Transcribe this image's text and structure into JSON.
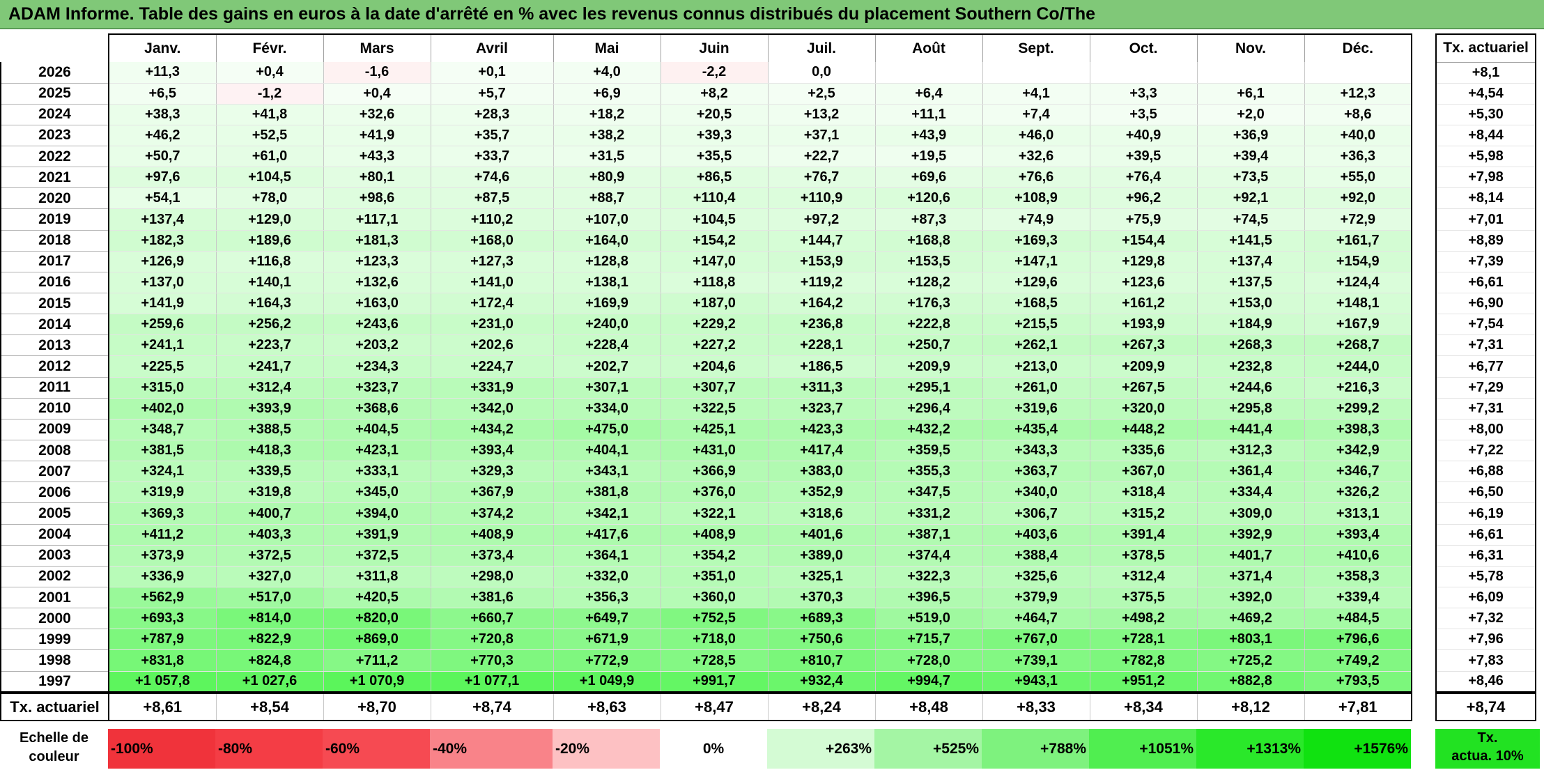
{
  "title": "ADAM Informe. Table des gains en euros à la date d'arrêté en % avec les revenus connus distribués du placement Southern Co/The",
  "months": [
    "Janv.",
    "Févr.",
    "Mars",
    "Avril",
    "Mai",
    "Juin",
    "Juil.",
    "Août",
    "Sept.",
    "Oct.",
    "Nov.",
    "Déc."
  ],
  "actuarial_header": "Tx. actuariel",
  "rows": [
    {
      "year": "2026",
      "cells": [
        "+11,3",
        "+0,4",
        "-1,6",
        "+0,1",
        "+4,0",
        "-2,2",
        "0,0",
        "",
        "",
        "",
        "",
        ""
      ],
      "rate": "+8,1"
    },
    {
      "year": "2025",
      "cells": [
        "+6,5",
        "-1,2",
        "+0,4",
        "+5,7",
        "+6,9",
        "+8,2",
        "+2,5",
        "+6,4",
        "+4,1",
        "+3,3",
        "+6,1",
        "+12,3"
      ],
      "rate": "+4,54"
    },
    {
      "year": "2024",
      "cells": [
        "+38,3",
        "+41,8",
        "+32,6",
        "+28,3",
        "+18,2",
        "+20,5",
        "+13,2",
        "+11,1",
        "+7,4",
        "+3,5",
        "+2,0",
        "+8,6"
      ],
      "rate": "+5,30"
    },
    {
      "year": "2023",
      "cells": [
        "+46,2",
        "+52,5",
        "+41,9",
        "+35,7",
        "+38,2",
        "+39,3",
        "+37,1",
        "+43,9",
        "+46,0",
        "+40,9",
        "+36,9",
        "+40,0"
      ],
      "rate": "+8,44"
    },
    {
      "year": "2022",
      "cells": [
        "+50,7",
        "+61,0",
        "+43,3",
        "+33,7",
        "+31,5",
        "+35,5",
        "+22,7",
        "+19,5",
        "+32,6",
        "+39,5",
        "+39,4",
        "+36,3"
      ],
      "rate": "+5,98"
    },
    {
      "year": "2021",
      "cells": [
        "+97,6",
        "+104,5",
        "+80,1",
        "+74,6",
        "+80,9",
        "+86,5",
        "+76,7",
        "+69,6",
        "+76,6",
        "+76,4",
        "+73,5",
        "+55,0"
      ],
      "rate": "+7,98"
    },
    {
      "year": "2020",
      "cells": [
        "+54,1",
        "+78,0",
        "+98,6",
        "+87,5",
        "+88,7",
        "+110,4",
        "+110,9",
        "+120,6",
        "+108,9",
        "+96,2",
        "+92,1",
        "+92,0"
      ],
      "rate": "+8,14"
    },
    {
      "year": "2019",
      "cells": [
        "+137,4",
        "+129,0",
        "+117,1",
        "+110,2",
        "+107,0",
        "+104,5",
        "+97,2",
        "+87,3",
        "+74,9",
        "+75,9",
        "+74,5",
        "+72,9"
      ],
      "rate": "+7,01"
    },
    {
      "year": "2018",
      "cells": [
        "+182,3",
        "+189,6",
        "+181,3",
        "+168,0",
        "+164,0",
        "+154,2",
        "+144,7",
        "+168,8",
        "+169,3",
        "+154,4",
        "+141,5",
        "+161,7"
      ],
      "rate": "+8,89"
    },
    {
      "year": "2017",
      "cells": [
        "+126,9",
        "+116,8",
        "+123,3",
        "+127,3",
        "+128,8",
        "+147,0",
        "+153,9",
        "+153,5",
        "+147,1",
        "+129,8",
        "+137,4",
        "+154,9"
      ],
      "rate": "+7,39"
    },
    {
      "year": "2016",
      "cells": [
        "+137,0",
        "+140,1",
        "+132,6",
        "+141,0",
        "+138,1",
        "+118,8",
        "+119,2",
        "+128,2",
        "+129,6",
        "+123,6",
        "+137,5",
        "+124,4"
      ],
      "rate": "+6,61"
    },
    {
      "year": "2015",
      "cells": [
        "+141,9",
        "+164,3",
        "+163,0",
        "+172,4",
        "+169,9",
        "+187,0",
        "+164,2",
        "+176,3",
        "+168,5",
        "+161,2",
        "+153,0",
        "+148,1"
      ],
      "rate": "+6,90"
    },
    {
      "year": "2014",
      "cells": [
        "+259,6",
        "+256,2",
        "+243,6",
        "+231,0",
        "+240,0",
        "+229,2",
        "+236,8",
        "+222,8",
        "+215,5",
        "+193,9",
        "+184,9",
        "+167,9"
      ],
      "rate": "+7,54"
    },
    {
      "year": "2013",
      "cells": [
        "+241,1",
        "+223,7",
        "+203,2",
        "+202,6",
        "+228,4",
        "+227,2",
        "+228,1",
        "+250,7",
        "+262,1",
        "+267,3",
        "+268,3",
        "+268,7"
      ],
      "rate": "+7,31"
    },
    {
      "year": "2012",
      "cells": [
        "+225,5",
        "+241,7",
        "+234,3",
        "+224,7",
        "+202,7",
        "+204,6",
        "+186,5",
        "+209,9",
        "+213,0",
        "+209,9",
        "+232,8",
        "+244,0"
      ],
      "rate": "+6,77"
    },
    {
      "year": "2011",
      "cells": [
        "+315,0",
        "+312,4",
        "+323,7",
        "+331,9",
        "+307,1",
        "+307,7",
        "+311,3",
        "+295,1",
        "+261,0",
        "+267,5",
        "+244,6",
        "+216,3"
      ],
      "rate": "+7,29"
    },
    {
      "year": "2010",
      "cells": [
        "+402,0",
        "+393,9",
        "+368,6",
        "+342,0",
        "+334,0",
        "+322,5",
        "+323,7",
        "+296,4",
        "+319,6",
        "+320,0",
        "+295,8",
        "+299,2"
      ],
      "rate": "+7,31"
    },
    {
      "year": "2009",
      "cells": [
        "+348,7",
        "+388,5",
        "+404,5",
        "+434,2",
        "+475,0",
        "+425,1",
        "+423,3",
        "+432,2",
        "+435,4",
        "+448,2",
        "+441,4",
        "+398,3"
      ],
      "rate": "+8,00"
    },
    {
      "year": "2008",
      "cells": [
        "+381,5",
        "+418,3",
        "+423,1",
        "+393,4",
        "+404,1",
        "+431,0",
        "+417,4",
        "+359,5",
        "+343,3",
        "+335,6",
        "+312,3",
        "+342,9"
      ],
      "rate": "+7,22"
    },
    {
      "year": "2007",
      "cells": [
        "+324,1",
        "+339,5",
        "+333,1",
        "+329,3",
        "+343,1",
        "+366,9",
        "+383,0",
        "+355,3",
        "+363,7",
        "+367,0",
        "+361,4",
        "+346,7"
      ],
      "rate": "+6,88"
    },
    {
      "year": "2006",
      "cells": [
        "+319,9",
        "+319,8",
        "+345,0",
        "+367,9",
        "+381,8",
        "+376,0",
        "+352,9",
        "+347,5",
        "+340,0",
        "+318,4",
        "+334,4",
        "+326,2"
      ],
      "rate": "+6,50"
    },
    {
      "year": "2005",
      "cells": [
        "+369,3",
        "+400,7",
        "+394,0",
        "+374,2",
        "+342,1",
        "+322,1",
        "+318,6",
        "+331,2",
        "+306,7",
        "+315,2",
        "+309,0",
        "+313,1"
      ],
      "rate": "+6,19"
    },
    {
      "year": "2004",
      "cells": [
        "+411,2",
        "+403,3",
        "+391,9",
        "+408,9",
        "+417,6",
        "+408,9",
        "+401,6",
        "+387,1",
        "+403,6",
        "+391,4",
        "+392,9",
        "+393,4"
      ],
      "rate": "+6,61"
    },
    {
      "year": "2003",
      "cells": [
        "+373,9",
        "+372,5",
        "+372,5",
        "+373,4",
        "+364,1",
        "+354,2",
        "+389,0",
        "+374,4",
        "+388,4",
        "+378,5",
        "+401,7",
        "+410,6"
      ],
      "rate": "+6,31"
    },
    {
      "year": "2002",
      "cells": [
        "+336,9",
        "+327,0",
        "+311,8",
        "+298,0",
        "+332,0",
        "+351,0",
        "+325,1",
        "+322,3",
        "+325,6",
        "+312,4",
        "+371,4",
        "+358,3"
      ],
      "rate": "+5,78"
    },
    {
      "year": "2001",
      "cells": [
        "+562,9",
        "+517,0",
        "+420,5",
        "+381,6",
        "+356,3",
        "+360,0",
        "+370,3",
        "+396,5",
        "+379,9",
        "+375,5",
        "+392,0",
        "+339,4"
      ],
      "rate": "+6,09"
    },
    {
      "year": "2000",
      "cells": [
        "+693,3",
        "+814,0",
        "+820,0",
        "+660,7",
        "+649,7",
        "+752,5",
        "+689,3",
        "+519,0",
        "+464,7",
        "+498,2",
        "+469,2",
        "+484,5"
      ],
      "rate": "+7,32"
    },
    {
      "year": "1999",
      "cells": [
        "+787,9",
        "+822,9",
        "+869,0",
        "+720,8",
        "+671,9",
        "+718,0",
        "+750,6",
        "+715,7",
        "+767,0",
        "+728,1",
        "+803,1",
        "+796,6"
      ],
      "rate": "+7,96"
    },
    {
      "year": "1998",
      "cells": [
        "+831,8",
        "+824,8",
        "+711,2",
        "+770,3",
        "+772,9",
        "+728,5",
        "+810,7",
        "+728,0",
        "+739,1",
        "+782,8",
        "+725,2",
        "+749,2"
      ],
      "rate": "+7,83"
    },
    {
      "year": "1997",
      "cells": [
        "+1 057,8",
        "+1 027,6",
        "+1 070,9",
        "+1 077,1",
        "+1 049,9",
        "+991,7",
        "+932,4",
        "+994,7",
        "+943,1",
        "+951,2",
        "+882,8",
        "+793,5"
      ],
      "rate": "+8,46"
    }
  ],
  "footer": {
    "label": "Tx. actuariel",
    "values": [
      "+8,61",
      "+8,54",
      "+8,70",
      "+8,74",
      "+8,63",
      "+8,47",
      "+8,24",
      "+8,48",
      "+8,33",
      "+8,34",
      "+8,12",
      "+7,81"
    ],
    "total": "+8,74"
  },
  "scale": {
    "label_line1": "Echelle de",
    "label_line2": "couleur",
    "items": [
      {
        "label": "-100%",
        "color": "#f0333b"
      },
      {
        "label": "-80%",
        "color": "#f43d45"
      },
      {
        "label": "-60%",
        "color": "#f64a52"
      },
      {
        "label": "-40%",
        "color": "#f98389"
      },
      {
        "label": "-20%",
        "color": "#fdc1c3"
      },
      {
        "label": "0%",
        "color": "#ffffff"
      },
      {
        "label": "+263%",
        "color": "#d4fbd4"
      },
      {
        "label": "+525%",
        "color": "#a4f5a4"
      },
      {
        "label": "+788%",
        "color": "#7ef27e"
      },
      {
        "label": "+1051%",
        "color": "#50ee50"
      },
      {
        "label": "+1313%",
        "color": "#2ae82a"
      },
      {
        "label": "+1576%",
        "color": "#10e210"
      }
    ],
    "actuarial_line1": "Tx.",
    "actuarial_line2": "actua. 10%",
    "actuarial_color": "#22e222"
  },
  "colors": {
    "title_bar": "#80c878",
    "positive_max": "#10e210",
    "negative_max": "#f0333b"
  }
}
